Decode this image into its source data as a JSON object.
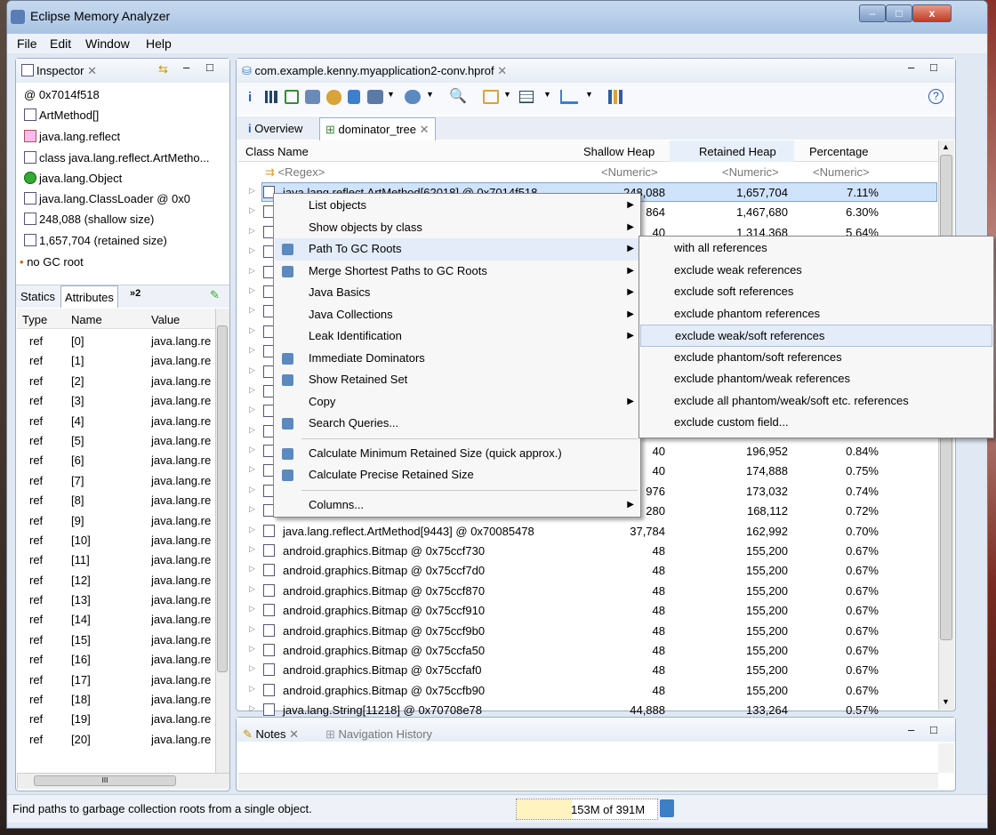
{
  "window": {
    "title": "Eclipse Memory Analyzer",
    "min_label": "–",
    "max_label": "□",
    "close_label": "x"
  },
  "menubar": [
    "File",
    "Edit",
    "Window",
    "Help"
  ],
  "inspector": {
    "title": "Inspector",
    "address": "0x7014f518",
    "type": "ArtMethod[]",
    "package": "java.lang.reflect",
    "class_label": "class java.lang.reflect.ArtMetho...",
    "superclass": "java.lang.Object",
    "classloader": "java.lang.ClassLoader @ 0x0",
    "shallow": "248,088 (shallow size)",
    "retained": "1,657,704 (retained size)",
    "gcroot": "no GC root",
    "tabs": [
      "Statics",
      "Attributes",
      "»2"
    ],
    "columns": [
      "Type",
      "Name",
      "Value"
    ],
    "rows": [
      {
        "type": "ref",
        "name": "[0]",
        "value": "java.lang.re"
      },
      {
        "type": "ref",
        "name": "[1]",
        "value": "java.lang.re"
      },
      {
        "type": "ref",
        "name": "[2]",
        "value": "java.lang.re"
      },
      {
        "type": "ref",
        "name": "[3]",
        "value": "java.lang.re"
      },
      {
        "type": "ref",
        "name": "[4]",
        "value": "java.lang.re"
      },
      {
        "type": "ref",
        "name": "[5]",
        "value": "java.lang.re"
      },
      {
        "type": "ref",
        "name": "[6]",
        "value": "java.lang.re"
      },
      {
        "type": "ref",
        "name": "[7]",
        "value": "java.lang.re"
      },
      {
        "type": "ref",
        "name": "[8]",
        "value": "java.lang.re"
      },
      {
        "type": "ref",
        "name": "[9]",
        "value": "java.lang.re"
      },
      {
        "type": "ref",
        "name": "[10]",
        "value": "java.lang.re"
      },
      {
        "type": "ref",
        "name": "[11]",
        "value": "java.lang.re"
      },
      {
        "type": "ref",
        "name": "[12]",
        "value": "java.lang.re"
      },
      {
        "type": "ref",
        "name": "[13]",
        "value": "java.lang.re"
      },
      {
        "type": "ref",
        "name": "[14]",
        "value": "java.lang.re"
      },
      {
        "type": "ref",
        "name": "[15]",
        "value": "java.lang.re"
      },
      {
        "type": "ref",
        "name": "[16]",
        "value": "java.lang.re"
      },
      {
        "type": "ref",
        "name": "[17]",
        "value": "java.lang.re"
      },
      {
        "type": "ref",
        "name": "[18]",
        "value": "java.lang.re"
      },
      {
        "type": "ref",
        "name": "[19]",
        "value": "java.lang.re"
      },
      {
        "type": "ref",
        "name": "[20]",
        "value": "java.lang.re"
      }
    ],
    "hscroll_grip": "III"
  },
  "editor": {
    "tab_title": "com.example.kenny.myapplication2-conv.hprof",
    "toolbar_info": "i",
    "help": "?",
    "subtabs": {
      "overview": "Overview",
      "dominator": "dominator_tree"
    },
    "columns": {
      "class": "Class Name",
      "shallow": "Shallow Heap",
      "retained": "Retained Heap",
      "pct": "Percentage"
    },
    "filter": {
      "regex": "<Regex>",
      "numeric": "<Numeric>"
    },
    "rows": [
      {
        "name": "java.lang.reflect.ArtMethod[62018] @ 0x7014f518",
        "shallow": "248,088",
        "retained": "1,657,704",
        "pct": "7.11%"
      },
      {
        "name": "",
        "shallow": "864",
        "retained": "1,467,680",
        "pct": "6.30%"
      },
      {
        "name": "",
        "shallow": "40",
        "retained": "1,314,368",
        "pct": "5.64%"
      },
      {
        "name": "",
        "shallow": "",
        "retained": "",
        "pct": ""
      },
      {
        "name": "",
        "shallow": "",
        "retained": "",
        "pct": ""
      },
      {
        "name": "",
        "shallow": "",
        "retained": "",
        "pct": ""
      },
      {
        "name": "",
        "shallow": "",
        "retained": "",
        "pct": ""
      },
      {
        "name": "",
        "shallow": "",
        "retained": "",
        "pct": ""
      },
      {
        "name": "",
        "shallow": "",
        "retained": "",
        "pct": ""
      },
      {
        "name": "",
        "shallow": "",
        "retained": "",
        "pct": ""
      },
      {
        "name": "",
        "shallow": "",
        "retained": "",
        "pct": ""
      },
      {
        "name": "",
        "shallow": "",
        "retained": "",
        "pct": ""
      },
      {
        "name": "",
        "shallow": "",
        "retained": "",
        "pct": ""
      },
      {
        "name": "",
        "shallow": "40",
        "retained": "196,952",
        "pct": "0.84%"
      },
      {
        "name": "",
        "shallow": "40",
        "retained": "174,888",
        "pct": "0.75%"
      },
      {
        "name": "",
        "shallow": "976",
        "retained": "173,032",
        "pct": "0.74%"
      },
      {
        "name": "",
        "shallow": "280",
        "retained": "168,112",
        "pct": "0.72%"
      },
      {
        "name": "java.lang.reflect.ArtMethod[9443] @ 0x70085478",
        "shallow": "37,784",
        "retained": "162,992",
        "pct": "0.70%"
      },
      {
        "name": "android.graphics.Bitmap @ 0x75ccf730",
        "shallow": "48",
        "retained": "155,200",
        "pct": "0.67%"
      },
      {
        "name": "android.graphics.Bitmap @ 0x75ccf7d0",
        "shallow": "48",
        "retained": "155,200",
        "pct": "0.67%"
      },
      {
        "name": "android.graphics.Bitmap @ 0x75ccf870",
        "shallow": "48",
        "retained": "155,200",
        "pct": "0.67%"
      },
      {
        "name": "android.graphics.Bitmap @ 0x75ccf910",
        "shallow": "48",
        "retained": "155,200",
        "pct": "0.67%"
      },
      {
        "name": "android.graphics.Bitmap @ 0x75ccf9b0",
        "shallow": "48",
        "retained": "155,200",
        "pct": "0.67%"
      },
      {
        "name": "android.graphics.Bitmap @ 0x75ccfa50",
        "shallow": "48",
        "retained": "155,200",
        "pct": "0.67%"
      },
      {
        "name": "android.graphics.Bitmap @ 0x75ccfaf0",
        "shallow": "48",
        "retained": "155,200",
        "pct": "0.67%"
      },
      {
        "name": "android.graphics.Bitmap @ 0x75ccfb90",
        "shallow": "48",
        "retained": "155,200",
        "pct": "0.67%"
      },
      {
        "name": "java.lang.String[11218] @ 0x70708e78",
        "shallow": "44,888",
        "retained": "133,264",
        "pct": "0.57%"
      }
    ]
  },
  "context_menu": [
    {
      "label": "List objects",
      "sub": true
    },
    {
      "label": "Show objects by class",
      "sub": true
    },
    {
      "label": "Path To GC Roots",
      "sub": true
    },
    {
      "label": "Merge Shortest Paths to GC Roots",
      "sub": true
    },
    {
      "label": "Java Basics",
      "sub": true
    },
    {
      "label": "Java Collections",
      "sub": true
    },
    {
      "label": "Leak Identification",
      "sub": true
    },
    {
      "label": "Immediate Dominators",
      "sub": false
    },
    {
      "label": "Show Retained Set",
      "sub": false
    },
    {
      "label": "Copy",
      "sub": true
    },
    {
      "label": "Search Queries...",
      "sub": false
    },
    {
      "label": "Calculate Minimum Retained Size (quick approx.)",
      "sub": false
    },
    {
      "label": "Calculate Precise Retained Size",
      "sub": false
    },
    {
      "label": "Columns...",
      "sub": true
    }
  ],
  "submenu": [
    "with all references",
    "exclude weak references",
    "exclude soft references",
    "exclude phantom references",
    "exclude weak/soft references",
    "exclude phantom/soft references",
    "exclude phantom/weak references",
    "exclude all phantom/weak/soft etc. references",
    "exclude custom field..."
  ],
  "bottom": {
    "notes": "Notes",
    "nav_history": "Navigation History"
  },
  "status": {
    "text": "Find paths to garbage collection roots from a single object.",
    "heap": "153M of 391M",
    "heap_used_fraction": 0.39
  },
  "colors": {
    "accent": "#3c7fd0",
    "selection": "#cfe3fb",
    "window": "#dfe8f3"
  }
}
